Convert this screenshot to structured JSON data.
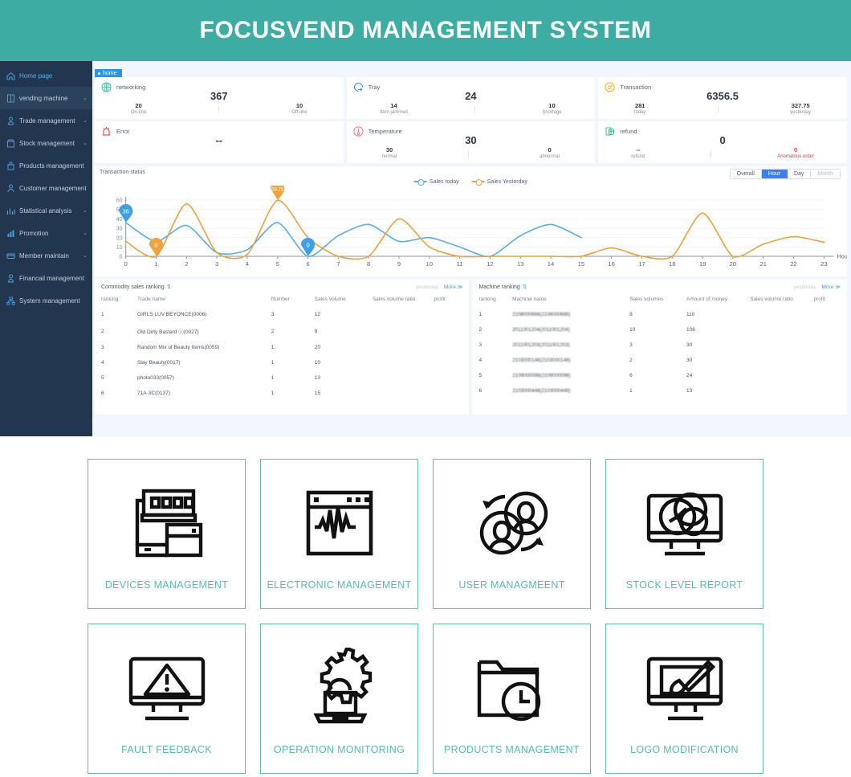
{
  "header": {
    "title": "FOCUSVEND MANAGEMENT SYSTEM",
    "bg_color": "#3dada3"
  },
  "sidebar": {
    "items": [
      {
        "label": "Home page",
        "icon": "home-icon",
        "active": true,
        "caret": ""
      },
      {
        "label": "vending machine",
        "icon": "machine-icon",
        "active": false,
        "caret": "⌄"
      },
      {
        "label": "Trade management",
        "icon": "trade-icon",
        "active": false,
        "caret": "⌄"
      },
      {
        "label": "Stock management",
        "icon": "stock-icon",
        "active": false,
        "caret": "⌄"
      },
      {
        "label": "Products management",
        "icon": "products-icon",
        "active": false,
        "caret": ""
      },
      {
        "label": "Customer management",
        "icon": "customer-icon",
        "active": false,
        "caret": ""
      },
      {
        "label": "Statistical analysis",
        "icon": "statistics-icon",
        "active": false,
        "caret": "⌄"
      },
      {
        "label": "Promotion",
        "icon": "promotion-icon",
        "active": false,
        "caret": "⌄"
      },
      {
        "label": "Member maintain",
        "icon": "member-icon",
        "active": false,
        "caret": "⌄"
      },
      {
        "label": "Financail management",
        "icon": "financial-icon",
        "active": false,
        "caret": ""
      },
      {
        "label": "System management",
        "icon": "system-icon",
        "active": false,
        "caret": ""
      }
    ]
  },
  "tab": {
    "label": "home"
  },
  "stats": [
    {
      "title": "networking",
      "icon": "globe-icon",
      "icon_color": "#3fc0a8",
      "big": "367",
      "subs": [
        {
          "value": "20",
          "label": "On-line",
          "danger": false
        },
        {
          "value": "10",
          "label": "Off-line",
          "danger": false
        }
      ]
    },
    {
      "title": "Tray",
      "icon": "tray-icon",
      "icon_color": "#2e9ed4",
      "big": "24",
      "subs": [
        {
          "value": "14",
          "label": "Item jammed",
          "danger": false
        },
        {
          "value": "10",
          "label": "Shortage",
          "danger": false
        }
      ]
    },
    {
      "title": "Transaction",
      "icon": "transaction-icon",
      "icon_color": "#f0b429",
      "big": "6356.5",
      "subs": [
        {
          "value": "281",
          "label": "today",
          "danger": false
        },
        {
          "value": "327.75",
          "label": "yesterday",
          "danger": false
        }
      ]
    },
    {
      "title": "Error",
      "icon": "error-icon",
      "icon_color": "#e8464c",
      "big": "--",
      "subs": []
    },
    {
      "title": "Temperature",
      "icon": "temperature-icon",
      "icon_color": "#ef7b8d",
      "big": "30",
      "subs": [
        {
          "value": "30",
          "label": "normal",
          "danger": false
        },
        {
          "value": "0",
          "label": "abnormal",
          "danger": false
        }
      ]
    },
    {
      "title": "refund",
      "icon": "refund-icon",
      "icon_color": "#3fb98c",
      "big": "0",
      "subs": [
        {
          "value": "--",
          "label": "refund",
          "danger": false
        },
        {
          "value": "0",
          "label": "Anomalous order",
          "danger": true
        }
      ]
    }
  ],
  "chart_panel": {
    "title": "Transaction status",
    "range_buttons": [
      {
        "label": "Overall",
        "active": false
      },
      {
        "label": "Hour",
        "active": true
      },
      {
        "label": "Day",
        "active": false
      },
      {
        "label": "Month",
        "active": false
      }
    ]
  },
  "chart_data": {
    "type": "line",
    "title": "Transaction status",
    "xlabel": "Hou",
    "ylabel": "",
    "xlim": [
      0,
      23
    ],
    "ylim": [
      0,
      60
    ],
    "yticks": [
      "0",
      "10",
      "20",
      "30",
      "40",
      "50",
      "60"
    ],
    "xticks": [
      "0",
      "1",
      "2",
      "3",
      "4",
      "5",
      "6",
      "7",
      "8",
      "9",
      "10",
      "11",
      "12",
      "13",
      "14",
      "15",
      "16",
      "17",
      "18",
      "19",
      "20",
      "21",
      "22",
      "23"
    ],
    "grid": true,
    "legend_position": "top-center",
    "series": [
      {
        "name": "Sales today",
        "color": "#5aaee8",
        "x": [
          0,
          1,
          2,
          3,
          4,
          5,
          6,
          7,
          8,
          9,
          10,
          11,
          12,
          13,
          14,
          15
        ],
        "values": [
          36,
          16,
          33,
          4,
          7,
          36,
          0,
          22,
          34,
          16,
          20,
          10,
          0,
          22,
          34,
          20
        ]
      },
      {
        "name": "Sales Yesterday",
        "color": "#eaa23c",
        "x": [
          0,
          1,
          2,
          3,
          4,
          5,
          6,
          7,
          8,
          9,
          10,
          11,
          12,
          13,
          14,
          15,
          16,
          17,
          18,
          19,
          20,
          21,
          22,
          23
        ],
        "values": [
          16,
          0,
          56,
          4,
          2,
          59.75,
          20,
          0,
          0,
          40,
          10,
          0,
          0,
          0,
          0,
          0,
          9,
          0,
          0,
          46,
          0,
          13,
          21,
          15
        ]
      }
    ],
    "annotations": [
      {
        "text": "36",
        "x": 0,
        "y": 36,
        "color": "#3ca0e8",
        "series": "Sales today"
      },
      {
        "text": "0",
        "x": 1,
        "y": 0,
        "color": "#f0a33c",
        "series": "Sales Yesterday"
      },
      {
        "text": "59.75",
        "x": 5,
        "y": 59.75,
        "color": "#f0a33c",
        "series": "Sales Yesterday"
      },
      {
        "text": "0",
        "x": 6,
        "y": 0,
        "color": "#3ca0e8",
        "series": "Sales today"
      }
    ]
  },
  "commodity_ranking": {
    "title": "Commodity sales ranking",
    "yesterday_label": "yesterday",
    "more_label": "More ≫",
    "columns": [
      "ranking",
      "Trade name",
      "Number",
      "Sales volume",
      "Sales volume ratio",
      "profit"
    ],
    "rows": [
      [
        "1",
        "GIRLS LUV BEYONCE(0006)",
        "3",
        "12",
        "",
        ""
      ],
      [
        "2",
        "Old Dirty Bastard ⓘ(0027)",
        "2",
        "8",
        "",
        ""
      ],
      [
        "3",
        "Random Mix of Beauty Items(0059)",
        "1",
        "20",
        "",
        ""
      ],
      [
        "4",
        "Slay Beauty(0017)",
        "1",
        "10",
        "",
        ""
      ],
      [
        "5",
        "photo033(0057)",
        "1",
        "13",
        "",
        ""
      ],
      [
        "6",
        "71A-3C(0137)",
        "1",
        "15",
        "",
        ""
      ]
    ]
  },
  "machine_ranking": {
    "title": "Machine ranking",
    "yesterday_label": "yesterday",
    "more_label": "More ≫",
    "columns": [
      "ranking",
      "Machine name",
      "Sales volumes",
      "Amount of money",
      "Sales volume ratio",
      "profit"
    ],
    "rows": [
      [
        "1",
        "2108000666(2108000666)",
        "8",
        "110",
        "",
        ""
      ],
      [
        "2",
        "2011001204(2011001204)",
        "10",
        "106",
        "",
        ""
      ],
      [
        "3",
        "2011001203(2011001203)",
        "3",
        "30",
        "",
        ""
      ],
      [
        "4",
        "2103000146(2103000146)",
        "2",
        "30",
        "",
        ""
      ],
      [
        "5",
        "2109000098(2109000098)",
        "6",
        "24",
        "",
        ""
      ],
      [
        "6",
        "2103000448(2103000448)",
        "1",
        "13",
        "",
        ""
      ]
    ]
  },
  "tiles": [
    {
      "label": "DEVICES MANAGEMENT",
      "icon": "vending-device-icon"
    },
    {
      "label": "ELECTRONIC MANAGEMENT",
      "icon": "waveform-window-icon"
    },
    {
      "label": "USER MANAGMEENT",
      "icon": "users-sync-icon"
    },
    {
      "label": "STOCK LEVEL REPORT",
      "icon": "monitor-chart-icon"
    },
    {
      "label": "FAULT FEEDBACK",
      "icon": "monitor-warning-icon"
    },
    {
      "label": "OPERATION MONITORING",
      "icon": "gear-laptop-icon"
    },
    {
      "label": "PRODUCTS MANAGEMENT",
      "icon": "folder-clock-icon"
    },
    {
      "label": "LOGO MODIFICATION",
      "icon": "monitor-brush-icon"
    }
  ],
  "colors": {
    "accent_teal": "#5bb9b0",
    "sidebar": "#22374f",
    "active_blue": "#3d7eff"
  }
}
